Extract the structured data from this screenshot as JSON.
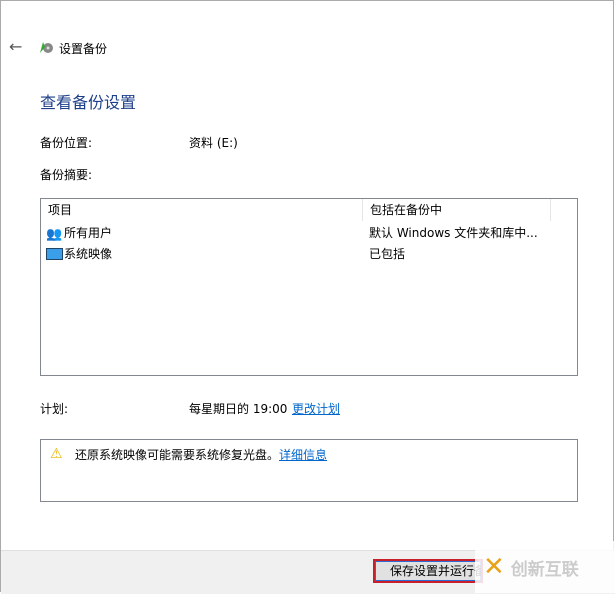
{
  "window": {
    "title": "设置备份",
    "heading": "查看备份设置"
  },
  "location": {
    "label": "备份位置:",
    "value": "资料 (E:)"
  },
  "summary": {
    "label": "备份摘要:",
    "columns": [
      "项目",
      "包括在备份中"
    ],
    "rows": [
      {
        "icon": "users-icon",
        "item": "所有用户",
        "included": "默认 Windows 文件夹和库中..."
      },
      {
        "icon": "monitor-icon",
        "item": "系统映像",
        "included": "已包括"
      }
    ]
  },
  "schedule": {
    "label": "计划:",
    "value": "每星期日的 19:00",
    "link": "更改计划"
  },
  "warning": {
    "text": "还原系统映像可能需要系统修复光盘。",
    "link": "详细信息"
  },
  "footer": {
    "save_button": "保存设置并运行备份"
  },
  "watermark": {
    "text": "创新互联"
  }
}
